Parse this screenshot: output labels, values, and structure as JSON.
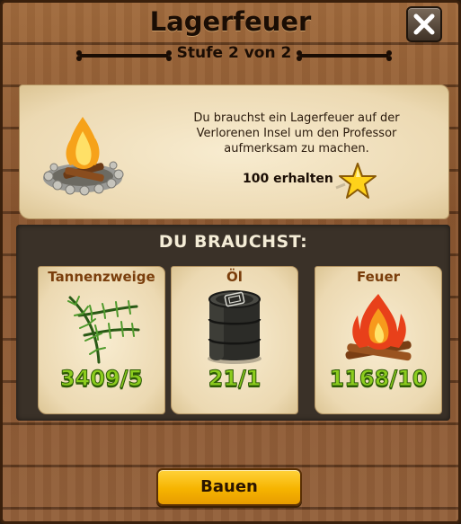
{
  "dialog": {
    "title": "Lagerfeuer",
    "subtitle": "Stufe 2 von 2"
  },
  "quest": {
    "description": "Du brauchst ein Lagerfeuer auf der Verlorenen Insel um den Professor aufmerksam zu machen.",
    "reward_label": "100 erhalten",
    "reward_icon": "star-icon"
  },
  "needs": {
    "header": "DU BRAUCHST:",
    "items": [
      {
        "name": "Tannenzweige",
        "count": "3409/5",
        "icon": "fir-branch-icon"
      },
      {
        "name": "Öl",
        "count": "21/1",
        "icon": "oil-barrel-icon"
      },
      {
        "name": "Feuer",
        "count": "1168/10",
        "icon": "fire-icon"
      }
    ]
  },
  "actions": {
    "build_label": "Bauen",
    "close_icon": "close-icon"
  },
  "colors": {
    "wood": "#8a5630",
    "parchment": "#f2e3c2",
    "count_green": "#8ccc1e",
    "button_yellow": "#f6b400",
    "item_name_brown": "#7a3e0c"
  }
}
